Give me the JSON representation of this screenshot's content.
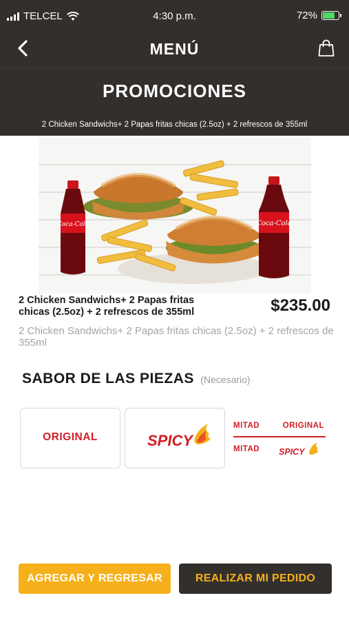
{
  "status_bar": {
    "carrier": "TELCEL",
    "time": "4:30 p.m.",
    "battery": "72%",
    "battery_level": 0.72
  },
  "nav": {
    "title": "MENÚ",
    "back_icon": "chevron-left-icon",
    "cart_icon": "shopping-bag-icon"
  },
  "promo": {
    "heading": "PROMOCIONES",
    "subtitle": "2 Chicken Sandwichs+ 2 Papas fritas chicas (2.5oz) + 2 refrescos de 355ml"
  },
  "product": {
    "name": "2 Chicken Sandwichs+ 2 Papas fritas chicas (2.5oz) + 2 refrescos de 355ml",
    "price": "$235.00",
    "description": "2 Chicken Sandwichs+ 2 Papas fritas chicas (2.5oz) + 2 refrescos de 355ml",
    "bottle_label": "Coca-Cola"
  },
  "flavor": {
    "title": "SABOR DE LAS PIEZAS",
    "required": "(Necesario)",
    "options": [
      {
        "label": "ORIGINAL"
      },
      {
        "label": "SPICY"
      },
      {
        "mitad": "MITAD",
        "original": "ORIGINAL",
        "spicy": "SPICY"
      }
    ]
  },
  "actions": {
    "add_back": "AGREGAR Y REGRESAR",
    "order": "REALIZAR MI PEDIDO"
  },
  "colors": {
    "dark": "#332f2c",
    "accent_yellow": "#f5b01b",
    "brand_red": "#d21d26"
  }
}
